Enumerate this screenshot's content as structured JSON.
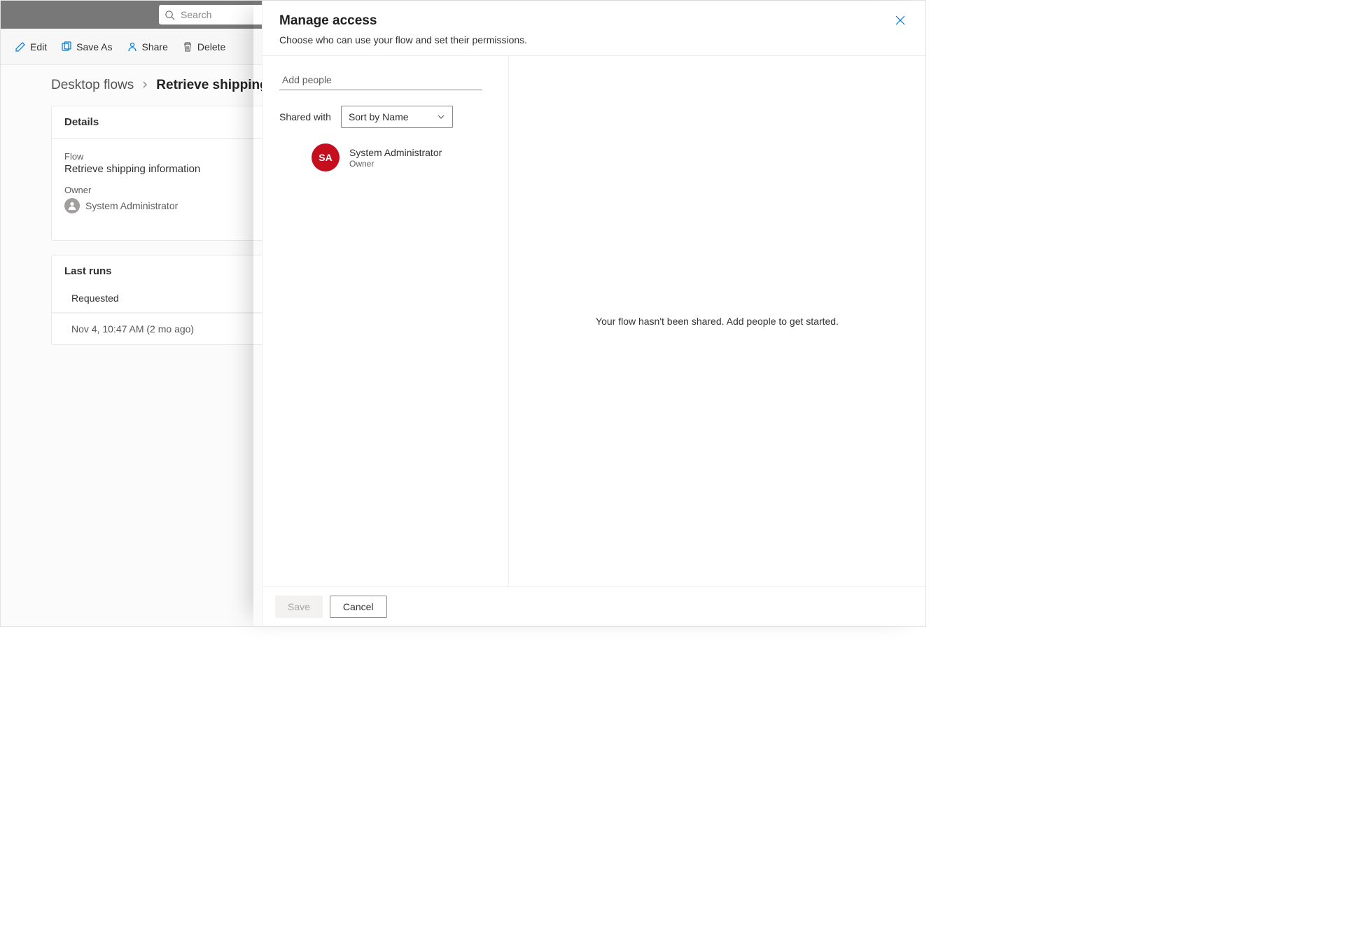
{
  "topbar": {
    "search_placeholder": "Search"
  },
  "cmdbar": {
    "edit": "Edit",
    "save_as": "Save As",
    "share": "Share",
    "delete": "Delete"
  },
  "breadcrumb": {
    "root": "Desktop flows",
    "current": "Retrieve shipping i"
  },
  "details": {
    "header": "Details",
    "flow_label": "Flow",
    "flow_value": "Retrieve shipping information",
    "owner_label": "Owner",
    "owner_value": "System Administrator"
  },
  "runs": {
    "header": "Last runs",
    "col_requested": "Requested",
    "row1": "Nov 4, 10:47 AM (2 mo ago)"
  },
  "modal": {
    "title": "Manage access",
    "subtitle": "Choose who can use your flow and set their permissions.",
    "add_placeholder": "Add people",
    "shared_with_label": "Shared with",
    "sort_value": "Sort by Name",
    "person_initials": "SA",
    "person_name": "System Administrator",
    "person_role": "Owner",
    "empty_message": "Your flow hasn't been shared. Add people to get started.",
    "save_label": "Save",
    "cancel_label": "Cancel"
  }
}
